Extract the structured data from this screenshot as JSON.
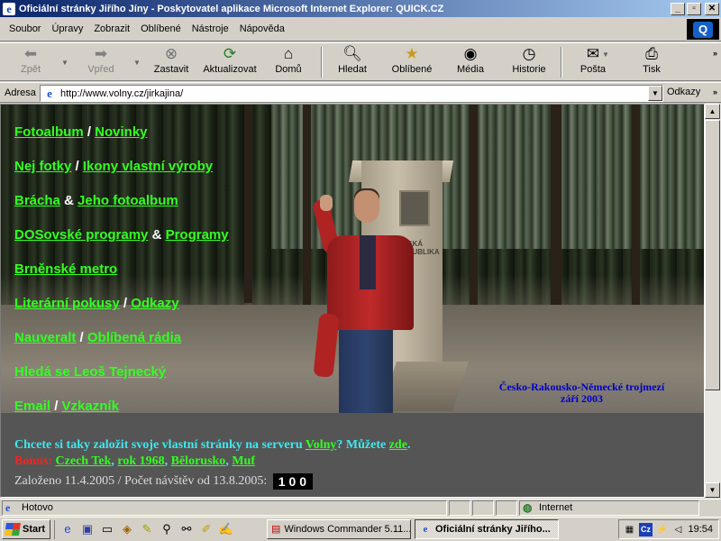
{
  "window": {
    "title": "Oficiální stránky Jiřího Jíny - Poskytovatel aplikace Microsoft Internet Explorer: QUICK.CZ",
    "controls": {
      "minimize": "_",
      "maximize": "▫",
      "close": "✕"
    }
  },
  "menu": {
    "items": [
      "Soubor",
      "Úpravy",
      "Zobrazit",
      "Oblíbené",
      "Nástroje",
      "Nápověda"
    ],
    "brand": "Q"
  },
  "toolbar": {
    "back": "Zpět",
    "forward": "Vpřed",
    "stop": "Zastavit",
    "refresh": "Aktualizovat",
    "home": "Domů",
    "search": "Hledat",
    "favorites": "Oblíbené",
    "media": "Média",
    "history": "Historie",
    "mail": "Pošta",
    "print": "Tisk"
  },
  "address": {
    "label": "Adresa",
    "url": "http://www.volny.cz/jirkajina/",
    "links_label": "Odkazy"
  },
  "page": {
    "nav": [
      {
        "a": "Fotoalbum",
        "sep": "/",
        "b": "Novinky"
      },
      {
        "a": "Nej fotky",
        "sep": "/",
        "b": "Ikony vlastní výroby"
      },
      {
        "a": "Brácha",
        "sep": "&",
        "b": "Jeho fotoalbum"
      },
      {
        "a": "DOSovské programy",
        "sep": "&",
        "b": "Programy"
      },
      {
        "a": "Brněnské metro",
        "sep": "",
        "b": ""
      },
      {
        "a": "Literární pokusy",
        "sep": "/",
        "b": "Odkazy"
      },
      {
        "a": "Nauveralt",
        "sep": "/",
        "b": "Oblíbená rádia"
      },
      {
        "a": "Hledá se Leoš Tejnecký",
        "sep": "",
        "b": ""
      },
      {
        "a": "Email",
        "sep": "/",
        "b": "Vzkazník"
      }
    ],
    "photo_caption_1": "Česko-Rakousko-Německé trojmezí",
    "photo_caption_2": "září 2003",
    "stone_text_1": "ČESKÁ",
    "stone_text_2": "REPUBLIKA",
    "promo_text": "Chcete si taky založit svoje vlastní stránky na serveru",
    "promo_link": "Volny",
    "promo_question": "? Můžete",
    "promo_here": "zde",
    "promo_end": ".",
    "bonus_label": "Bonus:",
    "bonus_links": [
      "Czech Tek",
      "rok 1968",
      "Bělorusko",
      "Muf"
    ],
    "founded_text": "Založeno 11.4.2005 / Počet návštěv od 13.8.2005:",
    "counter": "100"
  },
  "status": {
    "text": "Hotovo",
    "zone": "Internet"
  },
  "taskbar": {
    "start": "Start",
    "tasks": [
      {
        "label": "Windows Commander 5.11...",
        "active": false
      },
      {
        "label": "Oficiální stránky Jiřího...",
        "active": true
      }
    ],
    "tray_lang": "Cz",
    "clock": "19:54"
  },
  "colors": {
    "link_green": "#33ff22",
    "promo_cyan": "#3ee8f0",
    "bonus_red": "#ff2020",
    "caption_blue": "#0000c8",
    "title_gradient_start": "#0a246a",
    "title_gradient_end": "#a6caf0"
  },
  "icons": {
    "back": "back-arrow-icon",
    "forward": "forward-arrow-icon",
    "stop": "stop-icon",
    "refresh": "refresh-icon",
    "home": "home-icon",
    "search": "search-icon",
    "favorites": "favorites-icon",
    "media": "media-icon",
    "history": "history-icon",
    "mail": "mail-icon",
    "print": "print-icon"
  }
}
